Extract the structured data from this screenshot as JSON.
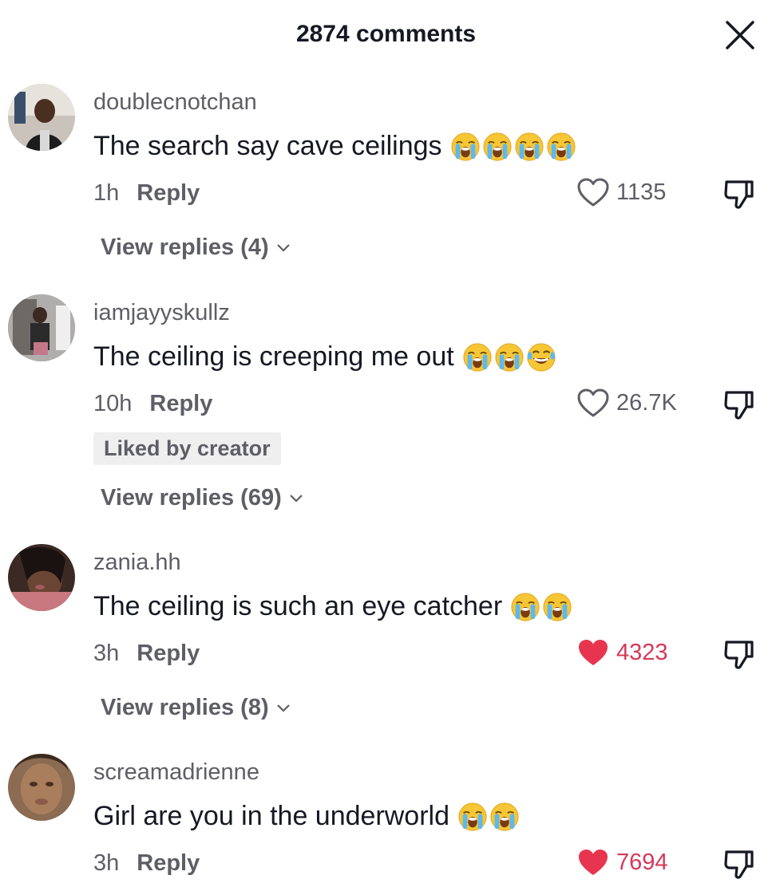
{
  "header": {
    "title": "2874 comments",
    "close_icon": "close-icon"
  },
  "comments": [
    {
      "username": "doublecnotchan",
      "text": "The search say cave ceilings",
      "emojis": [
        "loudly-crying-face",
        "loudly-crying-face",
        "loudly-crying-face",
        "loudly-crying-face"
      ],
      "time": "1h",
      "reply_label": "Reply",
      "likes": "1135",
      "liked": false,
      "view_replies": "View replies (4)"
    },
    {
      "username": "iamjayyskullz",
      "text": "The ceiling is creeping me out",
      "emojis": [
        "loudly-crying-face",
        "loudly-crying-face",
        "face-with-tears-of-joy"
      ],
      "time": "10h",
      "reply_label": "Reply",
      "likes": "26.7K",
      "liked": false,
      "badge": "Liked by creator",
      "view_replies": "View replies (69)"
    },
    {
      "username": "zania.hh",
      "text": "The ceiling is such an eye catcher",
      "emojis": [
        "loudly-crying-face",
        "loudly-crying-face"
      ],
      "time": "3h",
      "reply_label": "Reply",
      "likes": "4323",
      "liked": true,
      "view_replies": "View replies (8)"
    },
    {
      "username": "screamadrienne",
      "text": "Girl are you in the underworld",
      "emojis": [
        "loudly-crying-face",
        "loudly-crying-face"
      ],
      "time": "3h",
      "reply_label": "Reply",
      "likes": "7694",
      "liked": true
    }
  ],
  "colors": {
    "liked": "#d6385a",
    "secondary_text": "#5e5e66",
    "primary_text": "#161823",
    "badge_bg": "#efeff0"
  }
}
